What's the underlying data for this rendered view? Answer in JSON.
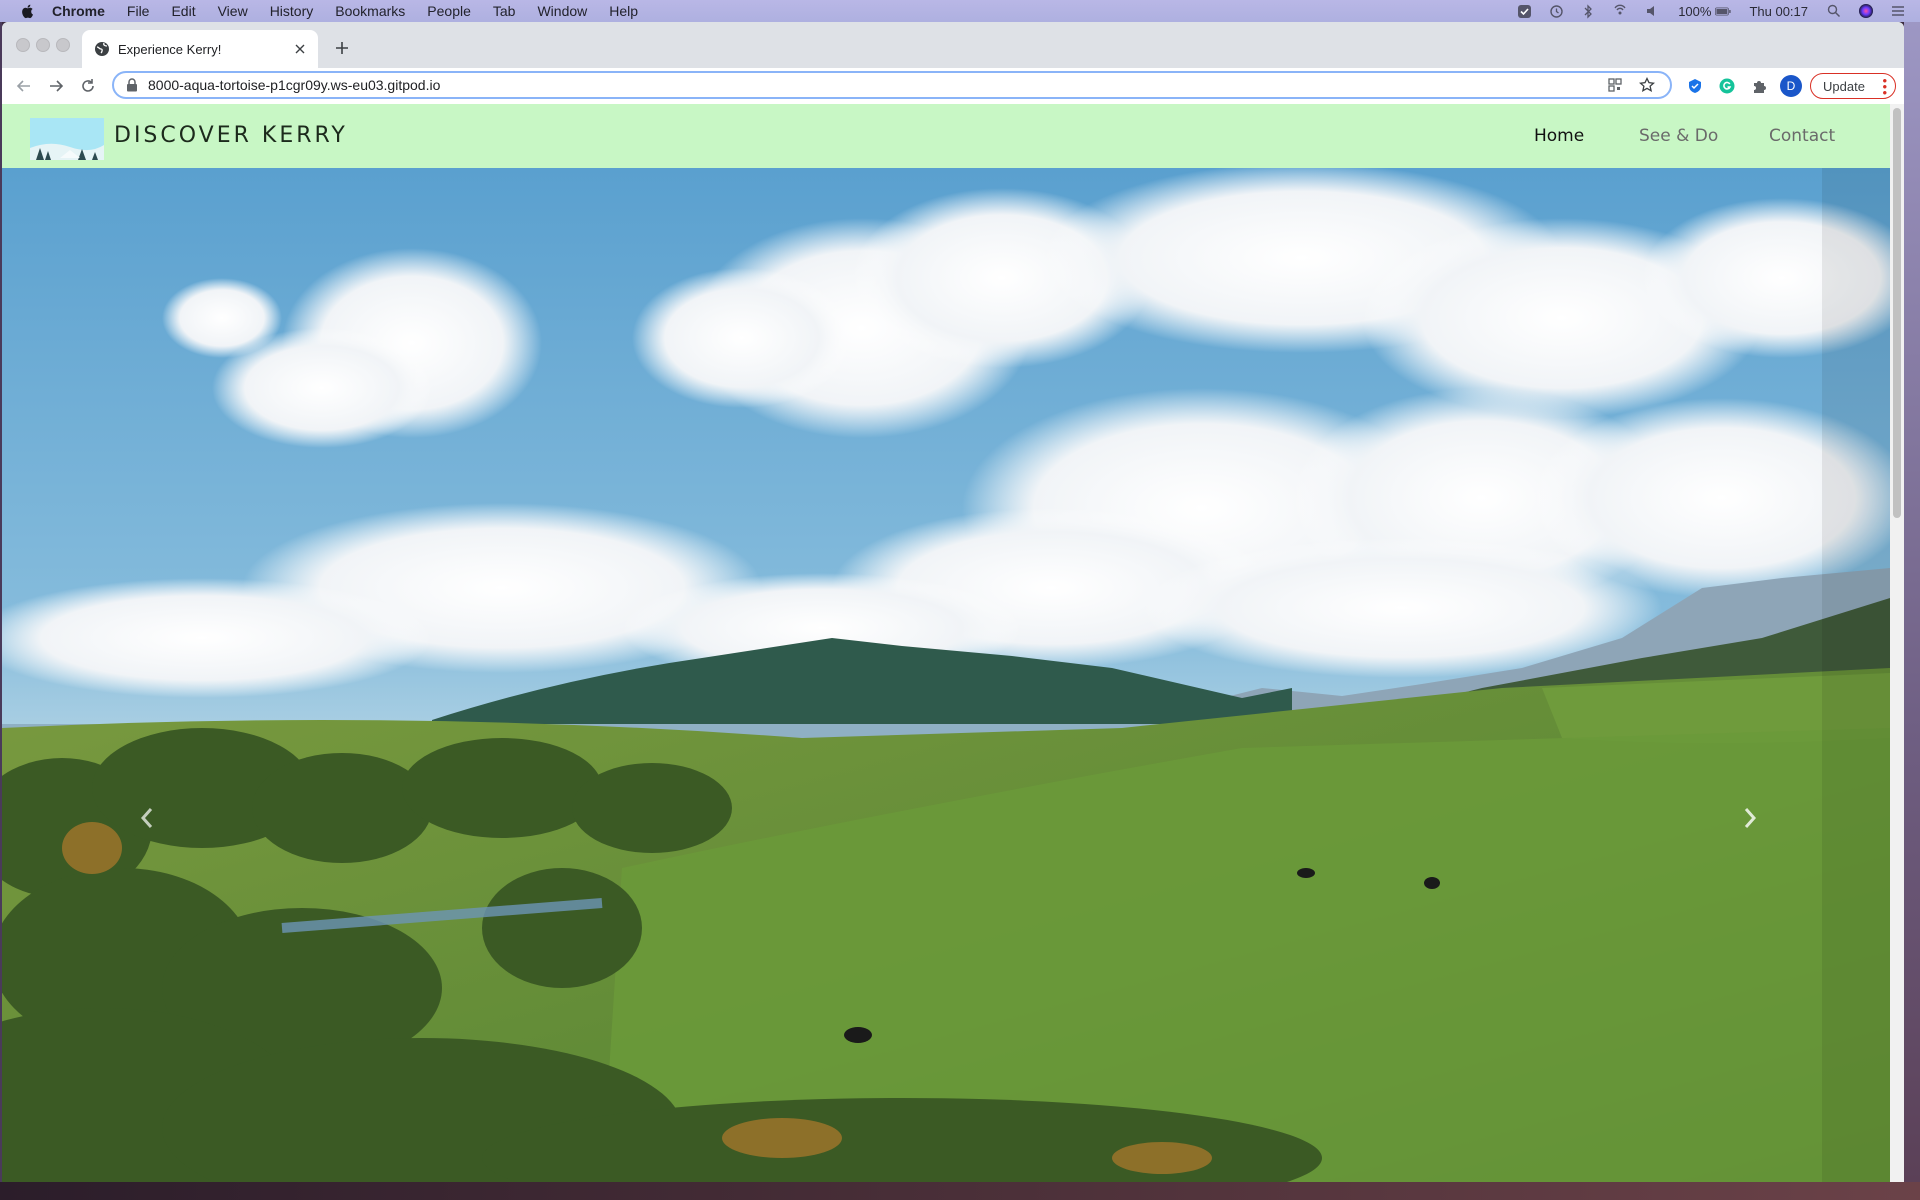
{
  "menubar": {
    "app": "Chrome",
    "items": [
      "File",
      "Edit",
      "View",
      "History",
      "Bookmarks",
      "People",
      "Tab",
      "Window",
      "Help"
    ],
    "battery": "100%",
    "clock": "Thu 00:17",
    "status_icons": [
      "check-icon",
      "time-machine-icon",
      "bluetooth-icon",
      "airplay-icon",
      "volume-icon",
      "battery-icon",
      "search-icon",
      "siri-icon",
      "control-center-icon"
    ]
  },
  "browser": {
    "tab_title": "Experience Kerry!",
    "url": "8000-aqua-tortoise-p1cgr09y.ws-eu03.gitpod.io",
    "profile_initial": "D",
    "update_label": "Update"
  },
  "site": {
    "brand": "DISCOVER KERRY",
    "nav": [
      {
        "label": "Home",
        "active": true
      },
      {
        "label": "See & Do",
        "active": false
      },
      {
        "label": "Contact",
        "active": false
      }
    ]
  }
}
